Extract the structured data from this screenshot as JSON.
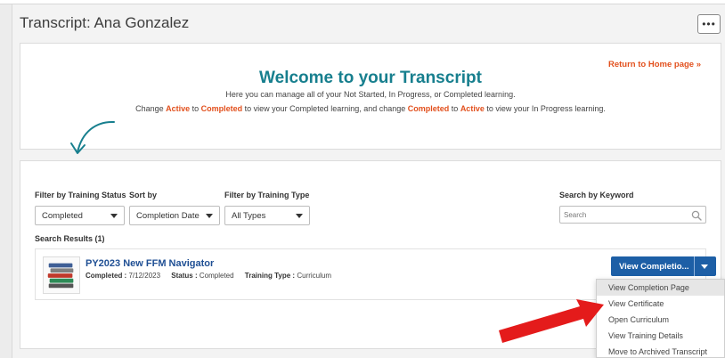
{
  "header": {
    "title": "Transcript: Ana Gonzalez",
    "more_label": "•••"
  },
  "welcome": {
    "return_link": "Return to Home page »",
    "title": "Welcome to your Transcript",
    "subtitle": "Here you can manage all of your Not Started, In Progress, or Completed learning.",
    "change_parts": [
      "Change ",
      "Active",
      " to ",
      "Completed",
      " to view your Completed learning, and change ",
      "Completed",
      " to ",
      "Active",
      " to view your In Progress learning."
    ]
  },
  "filters": {
    "status_label": "Filter by Training Status",
    "status_value": "Completed",
    "sort_label": "Sort by",
    "sort_value": "Completion Date",
    "type_label": "Filter by Training Type",
    "type_value": "All Types",
    "keyword_label": "Search by Keyword",
    "keyword_placeholder": "Search"
  },
  "results": {
    "label": "Search Results (1)",
    "items": [
      {
        "title": "PY2023 New FFM Navigator",
        "completed_label": "Completed :",
        "completed_value": "7/12/2023",
        "status_label": "Status :",
        "status_value": "Completed",
        "type_label": "Training Type :",
        "type_value": "Curriculum",
        "action_label": "View Completio..."
      }
    ]
  },
  "action_menu": {
    "items": [
      "View Completion Page",
      "View Certificate",
      "Open Curriculum",
      "View Training Details",
      "Move to Archived Transcript"
    ]
  },
  "colors": {
    "accent_teal": "#177f8e",
    "highlight_orange": "#e2501d",
    "primary_blue": "#1d5fa6",
    "title_blue": "#1f4f94",
    "annotation_red": "#e41b1b"
  },
  "icons": {
    "thumbnail": "books-stack-icon",
    "search": "magnifier-icon",
    "annotation_curve": "curved-arrow-icon",
    "annotation_pointer": "red-arrow-icon"
  }
}
